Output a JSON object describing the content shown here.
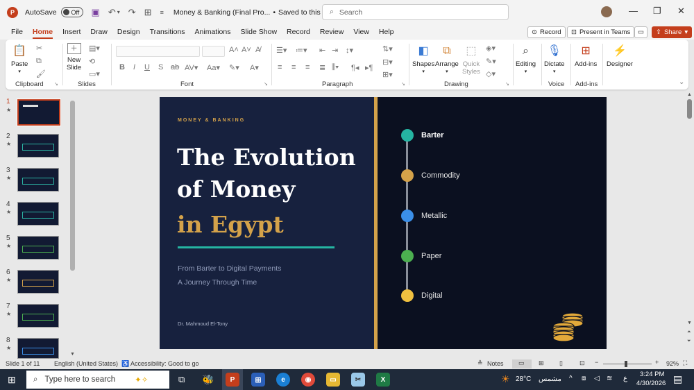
{
  "titlebar": {
    "autosave_label": "AutoSave",
    "autosave_state": "Off",
    "doc_title": "Money & Banking (Final Pro...",
    "save_status": "Saved to this PC",
    "search_placeholder": "Search"
  },
  "tabs": [
    "File",
    "Home",
    "Insert",
    "Draw",
    "Design",
    "Transitions",
    "Animations",
    "Slide Show",
    "Record",
    "Review",
    "View",
    "Help"
  ],
  "active_tab": "Home",
  "tab_right": {
    "record": "Record",
    "present_teams": "Present in Teams",
    "share": "Share"
  },
  "ribbon": {
    "paste": "Paste",
    "new_slide_1": "New",
    "new_slide_2": "Slide",
    "shapes": "Shapes",
    "arrange": "Arrange",
    "quick_styles_1": "Quick",
    "quick_styles_2": "Styles",
    "editing": "Editing",
    "dictate": "Dictate",
    "addins": "Add-ins",
    "designer": "Designer",
    "groups": {
      "clipboard": "Clipboard",
      "slides": "Slides",
      "font": "Font",
      "paragraph": "Paragraph",
      "drawing": "Drawing",
      "voice": "Voice",
      "addins": "Add-ins"
    }
  },
  "thumbnails": [
    "1",
    "2",
    "3",
    "4",
    "5",
    "6",
    "7",
    "8"
  ],
  "slide": {
    "kicker": "MONEY & BANKING",
    "title_line1": "The Evolution",
    "title_line2": "of Money",
    "title_line3": "in Egypt",
    "subtitle1": "From Barter to Digital Payments",
    "subtitle2": "A Journey Through Time",
    "author": "Dr. Mahmoud El-Tony",
    "timeline": [
      {
        "label": "Barter",
        "color": "#25b5a2"
      },
      {
        "label": "Commodity",
        "color": "#d4a24a"
      },
      {
        "label": "Metallic",
        "color": "#3b8fe8"
      },
      {
        "label": "Paper",
        "color": "#4caf50"
      },
      {
        "label": "Digital",
        "color": "#f0c040"
      }
    ]
  },
  "statusbar": {
    "slide_info": "Slide 1 of 11",
    "language": "English (United States)",
    "accessibility": "Accessibility: Good to go",
    "notes": "Notes",
    "zoom": "92%"
  },
  "taskbar": {
    "search_placeholder": "Type here to search",
    "temperature": "28°C",
    "weather": "مشمس",
    "time": "3:24 PM",
    "date": "4/30/2026",
    "lang": "ع"
  }
}
